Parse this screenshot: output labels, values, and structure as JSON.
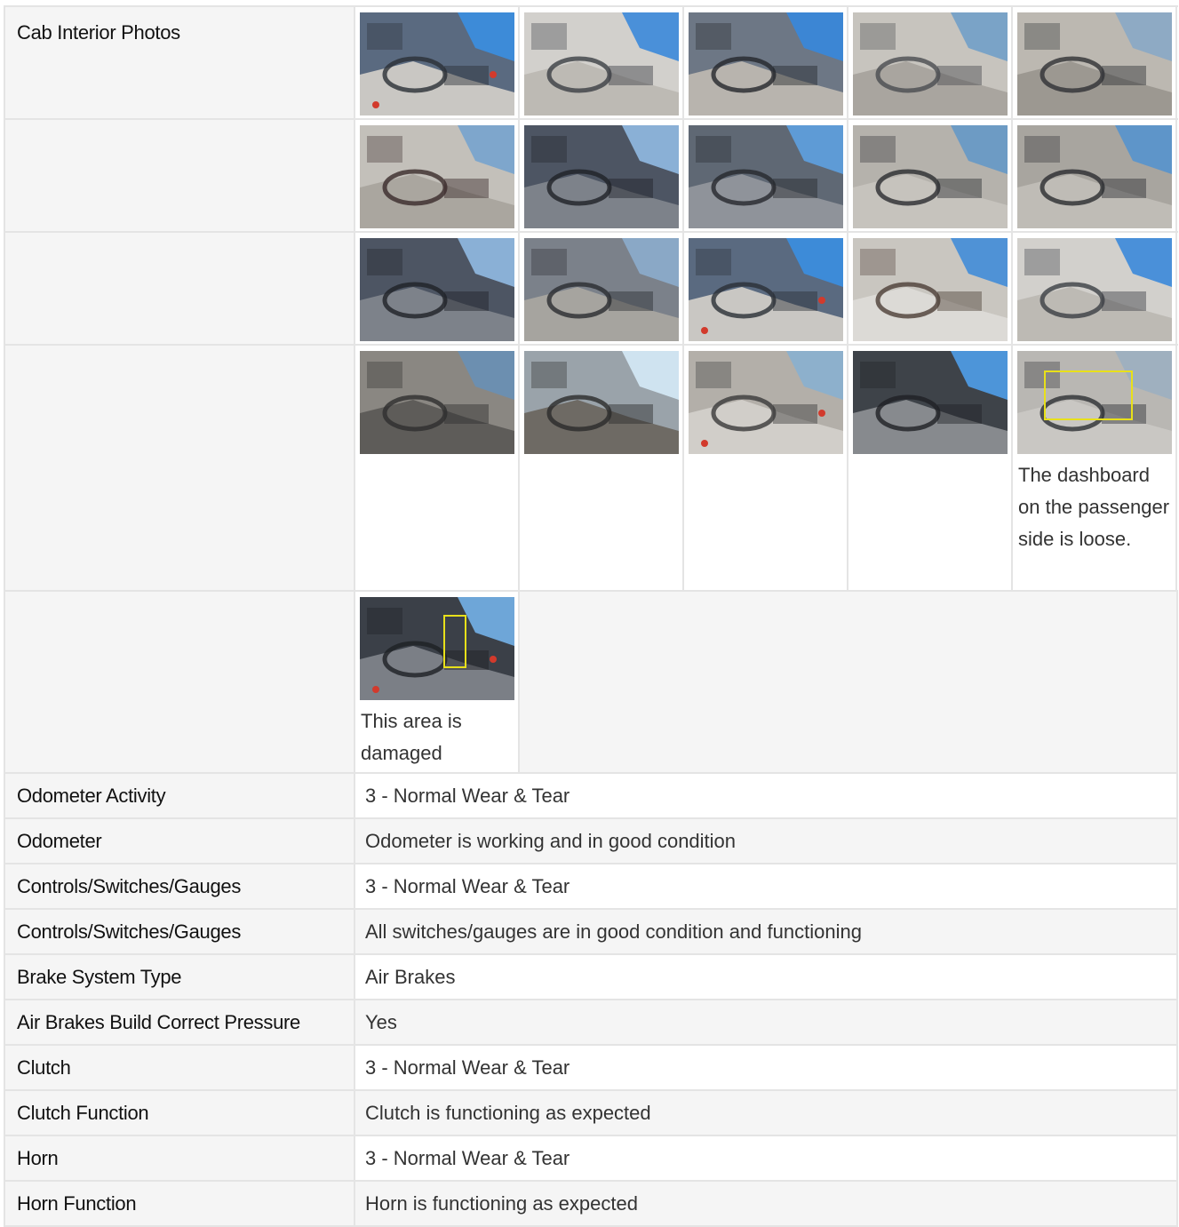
{
  "section_title": "Cab Interior Photos",
  "photo_rows": [
    {
      "label": "Cab Interior Photos",
      "photos": [
        {
          "name": "photo-door-open",
          "caption": "",
          "scene": "door"
        },
        {
          "name": "photo-headliner",
          "caption": "",
          "scene": "headliner"
        },
        {
          "name": "photo-steering-seat",
          "caption": "",
          "scene": "steering"
        },
        {
          "name": "photo-floor-mat",
          "caption": "",
          "scene": "floor"
        },
        {
          "name": "photo-passenger-floor",
          "caption": "",
          "scene": "floor2"
        }
      ]
    },
    {
      "label": "",
      "photos": [
        {
          "name": "photo-seat-base",
          "caption": "",
          "scene": "seatbase"
        },
        {
          "name": "photo-dashboard-wheel",
          "caption": "",
          "scene": "dash"
        },
        {
          "name": "photo-wheel-window",
          "caption": "",
          "scene": "dash2"
        },
        {
          "name": "photo-overhead-net",
          "caption": "",
          "scene": "overhead"
        },
        {
          "name": "photo-overhead-console",
          "caption": "",
          "scene": "overhead2"
        }
      ]
    },
    {
      "label": "",
      "photos": [
        {
          "name": "photo-dash-panel",
          "caption": "",
          "scene": "dash"
        },
        {
          "name": "photo-shifter",
          "caption": "",
          "scene": "shifter"
        },
        {
          "name": "photo-passenger-door",
          "caption": "",
          "scene": "door"
        },
        {
          "name": "photo-sleeper",
          "caption": "",
          "scene": "sleeper"
        },
        {
          "name": "photo-cab-rear",
          "caption": "",
          "scene": "headliner"
        }
      ]
    },
    {
      "label": "",
      "photos": [
        {
          "name": "photo-driver-seat",
          "caption": "",
          "scene": "seat"
        },
        {
          "name": "photo-cab-side",
          "caption": "",
          "scene": "seat2"
        },
        {
          "name": "photo-seat-belt",
          "caption": "",
          "scene": "seat3"
        },
        {
          "name": "photo-dash-passenger",
          "caption": "",
          "scene": "dash3"
        },
        {
          "name": "photo-loose-dash",
          "caption": "The dashboard on the passenger side is loose.",
          "scene": "loose",
          "highlight": true
        }
      ]
    },
    {
      "label": "",
      "photos": [
        {
          "name": "photo-damaged-area",
          "caption": "This area is damaged",
          "scene": "damaged",
          "highlight": true
        }
      ]
    }
  ],
  "rows": [
    {
      "label": "Odometer Activity",
      "value": "3 - Normal Wear & Tear"
    },
    {
      "label": "Odometer",
      "value": "Odometer is working and in good condition"
    },
    {
      "label": "Controls/Switches/Gauges",
      "value": "3 - Normal Wear & Tear"
    },
    {
      "label": "Controls/Switches/Gauges",
      "value": "All switches/gauges are in good condition and functioning"
    },
    {
      "label": "Brake System Type",
      "value": "Air Brakes"
    },
    {
      "label": "Air Brakes Build Correct Pressure",
      "value": "Yes"
    },
    {
      "label": "Clutch",
      "value": "3 - Normal Wear & Tear"
    },
    {
      "label": "Clutch Function",
      "value": "Clutch is functioning as expected"
    },
    {
      "label": "Horn",
      "value": "3 - Normal Wear & Tear"
    },
    {
      "label": "Horn Function",
      "value": "Horn is functioning as expected"
    }
  ],
  "colors": {
    "highlight": "#e8e01a",
    "label_bg": "#f5f5f5",
    "border": "#e4e4e4"
  }
}
